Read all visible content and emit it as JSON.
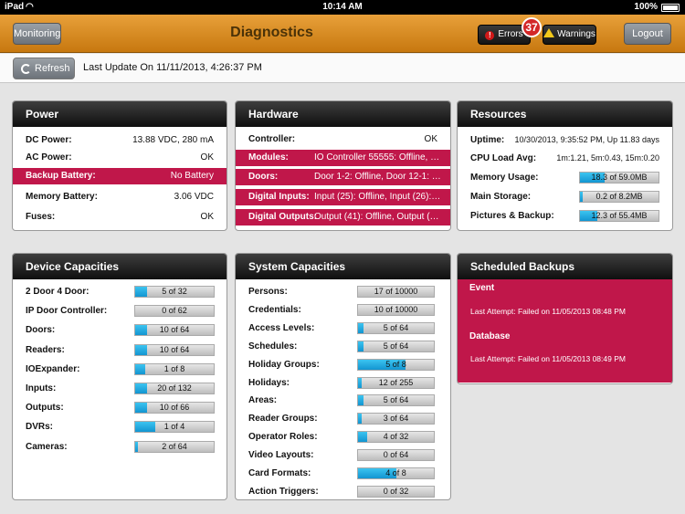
{
  "statusbar": {
    "device": "iPad",
    "time": "10:14 AM",
    "battery": "100%"
  },
  "nav": {
    "monitoring": "Monitoring",
    "title": "Diagnostics",
    "errors": "Errors",
    "errors_count": "37",
    "warnings": "Warnings",
    "logout": "Logout"
  },
  "toolbar": {
    "refresh": "Refresh",
    "last_update": "Last Update On 11/11/2013, 4:26:37 PM"
  },
  "power": {
    "title": "Power",
    "rows": [
      {
        "label": "DC Power:",
        "value": "13.88 VDC, 280 mA"
      },
      {
        "label": "AC Power:",
        "value": "OK"
      },
      {
        "label": "Backup Battery:",
        "value": "No Battery"
      },
      {
        "label": "Memory Battery:",
        "value": "3.06 VDC"
      },
      {
        "label": "Fuses:",
        "value": "OK"
      }
    ]
  },
  "hardware": {
    "title": "Hardware",
    "rows": [
      {
        "label": "Controller:",
        "value": "OK"
      },
      {
        "label": "Modules:",
        "value": "IO Controller 55555: Offline, Do..."
      },
      {
        "label": "Doors:",
        "value": "Door 1-2: Offline, Door 12-1: Offl..."
      },
      {
        "label": "Digital Inputs:",
        "value": "Input (25): Offline, Input (26): Of..."
      },
      {
        "label": "Digital Outputs:",
        "value": "Output (41): Offline, Output (42):..."
      }
    ]
  },
  "resources": {
    "title": "Resources",
    "uptime_label": "Uptime:",
    "uptime_value": "10/30/2013, 9:35:52 PM, Up 11.83 days",
    "cpu_label": "CPU Load Avg:",
    "cpu_value": "1m:1.21, 5m:0.43, 15m:0.20",
    "bars": [
      {
        "label": "Memory Usage:",
        "text": "18.3 of 59.0MB",
        "fraction": 0.31
      },
      {
        "label": "Main Storage:",
        "text": "0.2 of 8.2MB",
        "fraction": 0.03
      },
      {
        "label": "Pictures & Backup:",
        "text": "12.3 of 55.4MB",
        "fraction": 0.22
      }
    ]
  },
  "device_capacities": {
    "title": "Device Capacities",
    "rows": [
      {
        "label": "2 Door 4 Door:",
        "text": "5 of 32",
        "fraction": 0.156
      },
      {
        "label": "IP Door Controller:",
        "text": "0 of 62",
        "fraction": 0
      },
      {
        "label": "Doors:",
        "text": "10 of 64",
        "fraction": 0.156
      },
      {
        "label": "Readers:",
        "text": "10 of 64",
        "fraction": 0.156
      },
      {
        "label": "IOExpander:",
        "text": "1 of 8",
        "fraction": 0.125
      },
      {
        "label": "Inputs:",
        "text": "20 of 132",
        "fraction": 0.152
      },
      {
        "label": "Outputs:",
        "text": "10 of 66",
        "fraction": 0.152
      },
      {
        "label": "DVRs:",
        "text": "1 of 4",
        "fraction": 0.25
      },
      {
        "label": "Cameras:",
        "text": "2 of 64",
        "fraction": 0.031
      }
    ]
  },
  "system_capacities": {
    "title": "System Capacities",
    "rows": [
      {
        "label": "Persons:",
        "text": "17 of 10000",
        "fraction": 0.002
      },
      {
        "label": "Credentials:",
        "text": "10 of 10000",
        "fraction": 0.001
      },
      {
        "label": "Access Levels:",
        "text": "5 of 64",
        "fraction": 0.078
      },
      {
        "label": "Schedules:",
        "text": "5 of 64",
        "fraction": 0.078
      },
      {
        "label": "Holiday Groups:",
        "text": "5 of 8",
        "fraction": 0.625
      },
      {
        "label": "Holidays:",
        "text": "12 of 255",
        "fraction": 0.047
      },
      {
        "label": "Areas:",
        "text": "5 of 64",
        "fraction": 0.078
      },
      {
        "label": "Reader Groups:",
        "text": "3 of 64",
        "fraction": 0.047
      },
      {
        "label": "Operator Roles:",
        "text": "4 of 32",
        "fraction": 0.125
      },
      {
        "label": "Video Layouts:",
        "text": "0 of 64",
        "fraction": 0
      },
      {
        "label": "Card Formats:",
        "text": "4 of 8",
        "fraction": 0.5
      },
      {
        "label": "Action Triggers:",
        "text": "0 of 32",
        "fraction": 0
      }
    ]
  },
  "scheduled_backups": {
    "title": "Scheduled Backups",
    "items": [
      {
        "name": "Event",
        "text": "Last Attempt:  Failed on 11/05/2013 08:48 PM"
      },
      {
        "name": "Database",
        "text": "Last Attempt:  Failed on 11/05/2013 08:49 PM"
      }
    ]
  },
  "colors": {
    "accent_orange": "#d98b22",
    "alert_red": "#c0174a",
    "bar_blue": "#1ba7e0"
  }
}
